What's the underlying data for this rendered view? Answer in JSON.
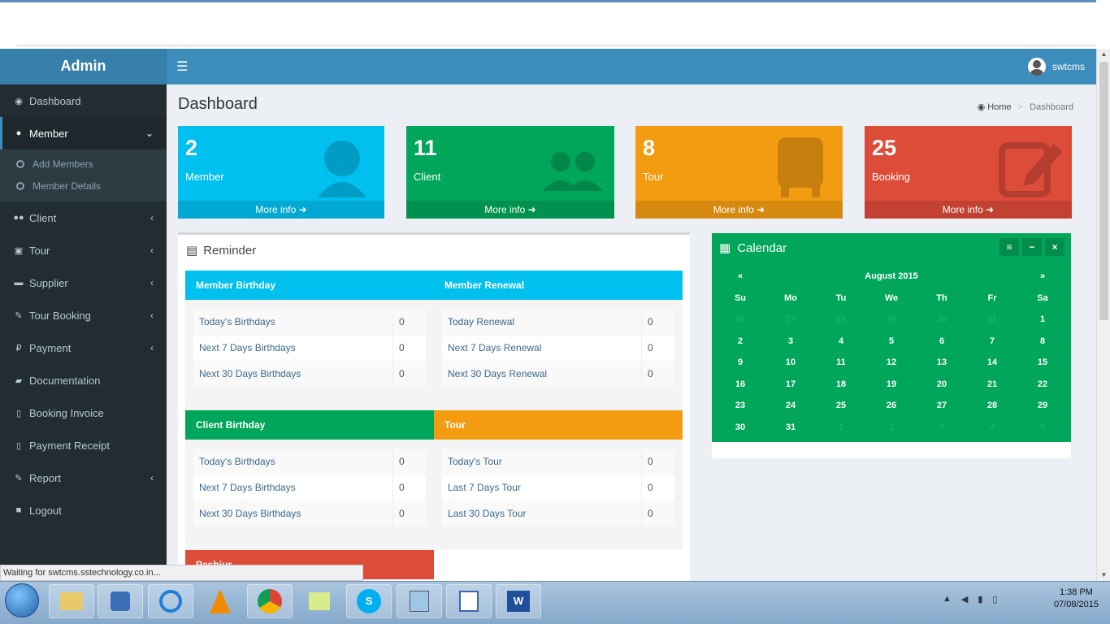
{
  "app": {
    "title": "Admin",
    "user": "swtcms"
  },
  "sidebar": {
    "items": [
      {
        "label": "Dashboard",
        "icon": "dashboard-icon"
      },
      {
        "label": "Member",
        "icon": "user-icon"
      },
      {
        "label": "Client",
        "icon": "users-icon"
      },
      {
        "label": "Tour",
        "icon": "bus-icon"
      },
      {
        "label": "Supplier",
        "icon": "car-icon"
      },
      {
        "label": "Tour Booking",
        "icon": "edit-icon"
      },
      {
        "label": "Payment",
        "icon": "payment-icon"
      },
      {
        "label": "Documentation",
        "icon": "book-icon"
      },
      {
        "label": "Booking Invoice",
        "icon": "file-icon"
      },
      {
        "label": "Payment Receipt",
        "icon": "file-icon"
      },
      {
        "label": "Report",
        "icon": "edit-icon"
      },
      {
        "label": "Logout",
        "icon": "lock-icon"
      }
    ],
    "sub_items": [
      "Add Members",
      "Member Details"
    ]
  },
  "page": {
    "title": "Dashboard"
  },
  "breadcrumb": {
    "home": "Home",
    "current": "Dashboard"
  },
  "stats": [
    {
      "value": "2",
      "label": "Member",
      "more": "More info",
      "color": "#00c0ef"
    },
    {
      "value": "11",
      "label": "Client",
      "more": "More info",
      "color": "#00a65a"
    },
    {
      "value": "8",
      "label": "Tour",
      "more": "More info",
      "color": "#f39c12"
    },
    {
      "value": "25",
      "label": "Booking",
      "more": "More info",
      "color": "#dd4b39"
    }
  ],
  "reminder": {
    "title": "Reminder",
    "panels": [
      {
        "title": "Member Birthday",
        "color": "#00c0ef",
        "rows": [
          {
            "label": "Today's Birthdays",
            "value": "0"
          },
          {
            "label": "Next 7 Days Birthdays",
            "value": "0"
          },
          {
            "label": "Next 30 Days Birthdays",
            "value": "0"
          }
        ]
      },
      {
        "title": "Member Renewal",
        "color": "#00c0ef",
        "rows": [
          {
            "label": "Today Renewal",
            "value": "0"
          },
          {
            "label": "Next 7 Days Renewal",
            "value": "0"
          },
          {
            "label": "Next 30 Days Renewal",
            "value": "0"
          }
        ]
      },
      {
        "title": "Client Birthday",
        "color": "#00a65a",
        "rows": [
          {
            "label": "Today's Birthdays",
            "value": "0"
          },
          {
            "label": "Next 7 Days Birthdays",
            "value": "0"
          },
          {
            "label": "Next 30 Days Birthdays",
            "value": "0"
          }
        ]
      },
      {
        "title": "Tour",
        "color": "#f39c12",
        "rows": [
          {
            "label": "Today's Tour",
            "value": "0"
          },
          {
            "label": "Last 7 Days Tour",
            "value": "0"
          },
          {
            "label": "Last 30 Days Tour",
            "value": "0"
          }
        ]
      },
      {
        "title": "Pashiur",
        "color": "#dd4b39",
        "rows": []
      }
    ]
  },
  "calendar": {
    "title": "Calendar",
    "month_label": "August 2015",
    "prev": "«",
    "next": "»",
    "weekdays": [
      "Su",
      "Mo",
      "Tu",
      "We",
      "Th",
      "Fr",
      "Sa"
    ],
    "weeks": [
      [
        "26",
        "27",
        "28",
        "29",
        "30",
        "31",
        "1"
      ],
      [
        "2",
        "3",
        "4",
        "5",
        "6",
        "7",
        "8"
      ],
      [
        "9",
        "10",
        "11",
        "12",
        "13",
        "14",
        "15"
      ],
      [
        "16",
        "17",
        "18",
        "19",
        "20",
        "21",
        "22"
      ],
      [
        "23",
        "24",
        "25",
        "26",
        "27",
        "28",
        "29"
      ],
      [
        "30",
        "31",
        "1",
        "2",
        "3",
        "4",
        "5"
      ]
    ],
    "tools": [
      "≡",
      "−",
      "×"
    ]
  },
  "browser": {
    "status": "Waiting for swtcms.sstechnology.co.in..."
  },
  "taskbar": {
    "time": "1:38 PM",
    "date": "07/08/2015"
  }
}
